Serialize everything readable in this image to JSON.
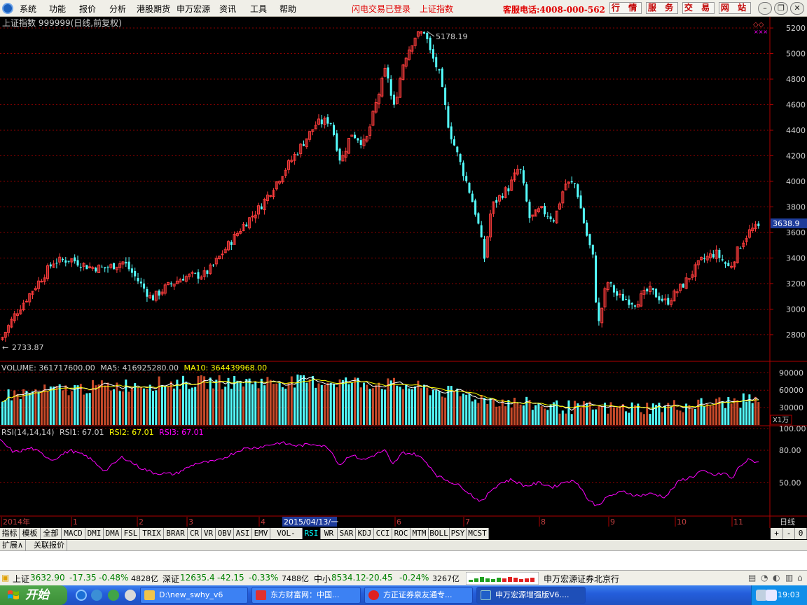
{
  "menubar": {
    "items": [
      "系统",
      "功能",
      "报价",
      "分析",
      "港股期货",
      "申万宏源",
      "资讯",
      "工具",
      "帮助"
    ],
    "status_flash": "闪电交易已登录",
    "status_index": "上证指数",
    "hotline": "客服电话:4008-000-562",
    "buttons": [
      "行 情",
      "服 务",
      "交 易",
      "网 站"
    ]
  },
  "chart": {
    "title": "上证指数 999999(日线,前复权)",
    "high_label": "5178.19",
    "low_label": "2733.87",
    "current_price": "3638.9",
    "y_ticks": [
      "5200",
      "5000",
      "4800",
      "4600",
      "4400",
      "4200",
      "4000",
      "3800",
      "3600",
      "3400",
      "3200",
      "3000",
      "2800"
    ],
    "volume_header": {
      "vol": "VOLUME: 361717600.00",
      "ma5": "MA5: 416925280.00",
      "ma10": "MA10: 364439968.00"
    },
    "volume_ticks": [
      "90000",
      "60000",
      "30000"
    ],
    "volume_unit": "X1万",
    "rsi_header": {
      "name": "RSI(14,14,14)",
      "rsi1": "RSI1: 67.01",
      "rsi2": "RSI2: 67.01",
      "rsi3": "RSI3: 67.01"
    },
    "rsi_ticks": [
      "100.00",
      "80.00",
      "50.00"
    ],
    "x_labels": [
      "2014年",
      "1",
      "2",
      "3",
      "4",
      "6",
      "7",
      "8",
      "9",
      "10",
      "11"
    ],
    "cursor_date": "2015/04/13/一",
    "period": "日线"
  },
  "chart_data": {
    "type": "candlestick",
    "title": "上证指数 999999(日线,前复权)",
    "ylim": [
      2650,
      5280
    ],
    "high": 5178.19,
    "low": 2733.87,
    "last": 3638.9,
    "price_path": [
      [
        0,
        2760
      ],
      [
        20,
        2960
      ],
      [
        45,
        3150
      ],
      [
        75,
        3370
      ],
      [
        100,
        3390
      ],
      [
        125,
        3330
      ],
      [
        150,
        3320
      ],
      [
        175,
        3370
      ],
      [
        200,
        3190
      ],
      [
        215,
        3080
      ],
      [
        235,
        3170
      ],
      [
        260,
        3250
      ],
      [
        290,
        3270
      ],
      [
        300,
        3320
      ],
      [
        320,
        3470
      ],
      [
        345,
        3650
      ],
      [
        370,
        3800
      ],
      [
        400,
        4050
      ],
      [
        425,
        4250
      ],
      [
        450,
        4450
      ],
      [
        470,
        4480
      ],
      [
        485,
        4150
      ],
      [
        500,
        4380
      ],
      [
        520,
        4290
      ],
      [
        535,
        4600
      ],
      [
        550,
        4900
      ],
      [
        560,
        4550
      ],
      [
        575,
        4950
      ],
      [
        590,
        5130
      ],
      [
        605,
        5178
      ],
      [
        612,
        5020
      ],
      [
        625,
        4850
      ],
      [
        640,
        4400
      ],
      [
        655,
        4150
      ],
      [
        670,
        3900
      ],
      [
        680,
        3700
      ],
      [
        690,
        3400
      ],
      [
        700,
        3800
      ],
      [
        715,
        3900
      ],
      [
        725,
        3950
      ],
      [
        740,
        4120
      ],
      [
        755,
        3700
      ],
      [
        770,
        3780
      ],
      [
        790,
        3700
      ],
      [
        805,
        3980
      ],
      [
        820,
        3980
      ],
      [
        835,
        3600
      ],
      [
        845,
        3400
      ],
      [
        852,
        2850
      ],
      [
        865,
        3220
      ],
      [
        880,
        3100
      ],
      [
        905,
        3050
      ],
      [
        925,
        3150
      ],
      [
        950,
        3050
      ],
      [
        975,
        3200
      ],
      [
        1000,
        3380
      ],
      [
        1020,
        3440
      ],
      [
        1040,
        3320
      ],
      [
        1055,
        3500
      ],
      [
        1070,
        3620
      ],
      [
        1083,
        3638
      ]
    ],
    "rsi_path": [
      [
        0,
        89
      ],
      [
        20,
        78
      ],
      [
        45,
        82
      ],
      [
        75,
        71
      ],
      [
        100,
        80
      ],
      [
        125,
        74
      ],
      [
        150,
        61
      ],
      [
        175,
        74
      ],
      [
        200,
        64
      ],
      [
        220,
        59
      ],
      [
        250,
        58
      ],
      [
        280,
        68
      ],
      [
        310,
        70
      ],
      [
        345,
        81
      ],
      [
        370,
        83
      ],
      [
        400,
        87
      ],
      [
        425,
        84
      ],
      [
        450,
        86
      ],
      [
        470,
        82
      ],
      [
        485,
        66
      ],
      [
        500,
        76
      ],
      [
        520,
        71
      ],
      [
        535,
        76
      ],
      [
        550,
        80
      ],
      [
        560,
        66
      ],
      [
        575,
        78
      ],
      [
        595,
        76
      ],
      [
        610,
        68
      ],
      [
        625,
        56
      ],
      [
        640,
        52
      ],
      [
        660,
        46
      ],
      [
        680,
        35
      ],
      [
        690,
        33
      ],
      [
        700,
        43
      ],
      [
        715,
        50
      ],
      [
        730,
        53
      ],
      [
        750,
        47
      ],
      [
        770,
        50
      ],
      [
        790,
        46
      ],
      [
        810,
        52
      ],
      [
        825,
        50
      ],
      [
        840,
        34
      ],
      [
        852,
        29
      ],
      [
        870,
        38
      ],
      [
        890,
        42
      ],
      [
        910,
        38
      ],
      [
        930,
        40
      ],
      [
        950,
        37
      ],
      [
        970,
        52
      ],
      [
        990,
        56
      ],
      [
        1000,
        61
      ],
      [
        1020,
        57
      ],
      [
        1035,
        59
      ],
      [
        1045,
        53
      ],
      [
        1055,
        65
      ],
      [
        1068,
        71
      ],
      [
        1083,
        69
      ]
    ],
    "rsi_range": [
      20,
      100
    ]
  },
  "indicator_tabs": {
    "tabs": [
      "指标",
      "模板",
      "全部",
      "MACD",
      "DMI",
      "DMA",
      "FSL",
      "TRIX",
      "BRAR",
      "CR",
      "VR",
      "OBV",
      "ASI",
      "EMV",
      "VOL-TDX",
      "RSI",
      "WR",
      "SAR",
      "KDJ",
      "CCI",
      "ROC",
      "MTM",
      "BOLL",
      "PSY",
      "MCST"
    ],
    "selected": "RSI",
    "right_controls": [
      "+",
      "-",
      "0"
    ]
  },
  "extension_row": [
    "扩展∧",
    "关联报价"
  ],
  "statusbar": {
    "sh_name": "上证",
    "sh_price": "3632.90",
    "sh_chg": "-17.35",
    "sh_pct": "-0.48%",
    "sh_amt": "4828亿",
    "sz_name": "深证",
    "sz_price": "12635.4",
    "sz_chg": "-42.15",
    "sz_pct": "-0.33%",
    "sz_amt": "7488亿",
    "zx_name": "中小",
    "zx_price": "8534.12",
    "zx_chg": "-20.45",
    "zx_pct": "-0.24%",
    "zx_amt": "3267亿",
    "branch": "申万宏源证券北京行"
  },
  "taskbar": {
    "start": "开始",
    "tasks": [
      "D:\\new_swhy_v6",
      "东方财富网：中国...",
      "方正证券泉友通专...",
      "申万宏源增强版V6...."
    ],
    "clock": "19:03"
  }
}
